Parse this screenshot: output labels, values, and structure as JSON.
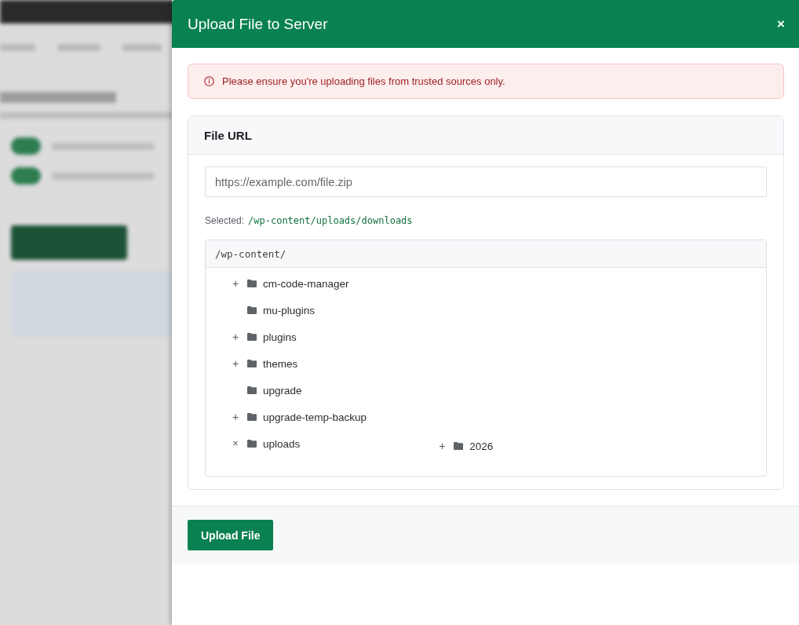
{
  "modal": {
    "title": "Upload File to Server",
    "close": "×"
  },
  "alert": {
    "text": "Please ensure you're uploading files from trusted sources only."
  },
  "card": {
    "title": "File URL",
    "url_field": {
      "placeholder": "https://example.com/file.zip"
    },
    "selected_label": "Selected:",
    "selected_path": "/wp-content/uploads/downloads",
    "tree": {
      "root": "/wp-content/",
      "items": [
        {
          "toggle": "+",
          "name": "cm-code-manager"
        },
        {
          "name": "mu-plugins"
        },
        {
          "toggle": "+",
          "name": "plugins"
        },
        {
          "toggle": "+",
          "name": "themes"
        },
        {
          "name": "upgrade"
        },
        {
          "toggle": "+",
          "name": "upgrade-temp-backup"
        },
        {
          "toggle": "×",
          "name": "uploads",
          "children": [
            {
              "toggle": "+",
              "name": "2026"
            }
          ]
        }
      ]
    }
  },
  "footer": {
    "button": "Upload File"
  }
}
